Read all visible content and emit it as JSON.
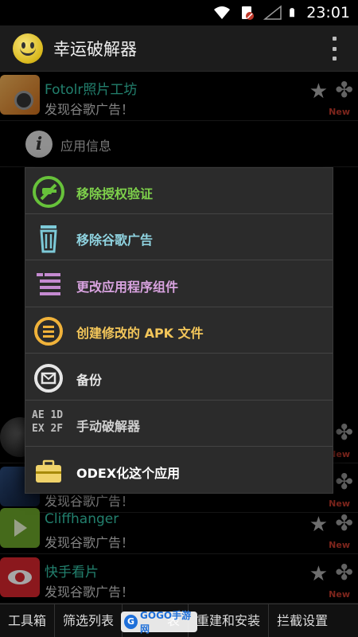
{
  "status_bar": {
    "time": "23:01"
  },
  "app_bar": {
    "title": "幸运破解器"
  },
  "info_row": {
    "label": "应用信息"
  },
  "apps": [
    {
      "name": "Fotolr照片工坊",
      "status": "发现谷歌广告！",
      "badge": "New"
    },
    {
      "name": "",
      "status": "",
      "badge": "New"
    },
    {
      "name": "",
      "status": "发现谷歌广告！",
      "badge": "New"
    },
    {
      "name": "Cliffhanger",
      "status": "发现谷歌广告！",
      "badge": "New"
    },
    {
      "name": "快手看片",
      "status": "发现谷歌广告！",
      "badge": "New"
    }
  ],
  "menu": {
    "items": [
      {
        "label": "移除授权验证",
        "color": "#7ed14b",
        "icon": "no-license-icon"
      },
      {
        "label": "移除谷歌广告",
        "color": "#8fd3e0",
        "icon": "trash-icon"
      },
      {
        "label": "更改应用程序组件",
        "color": "#d9a3e0",
        "icon": "components-icon"
      },
      {
        "label": "创建修改的 APK 文件",
        "color": "#f3c65a",
        "icon": "apk-create-icon"
      },
      {
        "label": "备份",
        "color": "#e6e6e6",
        "icon": "backup-icon"
      },
      {
        "label": "手动破解器",
        "color": "#d0d0d0",
        "icon": "manual-patcher-icon"
      },
      {
        "label": "ODEX化这个应用",
        "color": "#ffffff",
        "icon": "toolbox-icon"
      }
    ],
    "manual_icon_text": [
      "AE 1D",
      "EX 2F"
    ]
  },
  "bottom_tabs": [
    {
      "label": "工具箱"
    },
    {
      "label": "筛选列表"
    },
    {
      "label": "表"
    },
    {
      "label": "重建和安装"
    },
    {
      "label": "拦截设置"
    }
  ],
  "watermark": {
    "text": "GOGO手游网"
  },
  "colors": {
    "app_name": "#35c4a8",
    "new_badge": "#c0392b",
    "menu_bg": "#2b2b2b"
  }
}
